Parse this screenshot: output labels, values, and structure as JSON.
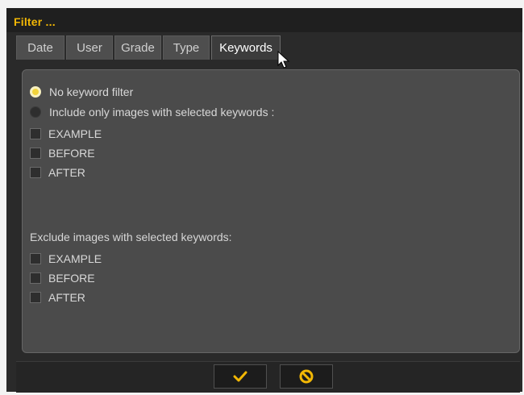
{
  "window": {
    "title": "Filter ..."
  },
  "tabs": [
    {
      "label": "Date"
    },
    {
      "label": "User"
    },
    {
      "label": "Grade"
    },
    {
      "label": "Type"
    },
    {
      "label": "Keywords"
    }
  ],
  "active_tab": "Keywords",
  "radios": [
    {
      "label": "No keyword filter",
      "checked": true
    },
    {
      "label": "Include only images with selected keywords :",
      "checked": false
    }
  ],
  "include_keywords": [
    {
      "label": "EXAMPLE",
      "checked": false
    },
    {
      "label": "BEFORE",
      "checked": false
    },
    {
      "label": "AFTER",
      "checked": false
    }
  ],
  "exclude_section": {
    "label": "Exclude images with selected keywords:",
    "keywords": [
      {
        "label": "EXAMPLE",
        "checked": false
      },
      {
        "label": "BEFORE",
        "checked": false
      },
      {
        "label": "AFTER",
        "checked": false
      }
    ]
  },
  "buttons": {
    "ok_icon": "checkmark-icon",
    "cancel_icon": "cancel-icon"
  },
  "colors": {
    "accent": "#f2b705",
    "panel": "#4b4b4b",
    "background": "#2a2a2a"
  }
}
